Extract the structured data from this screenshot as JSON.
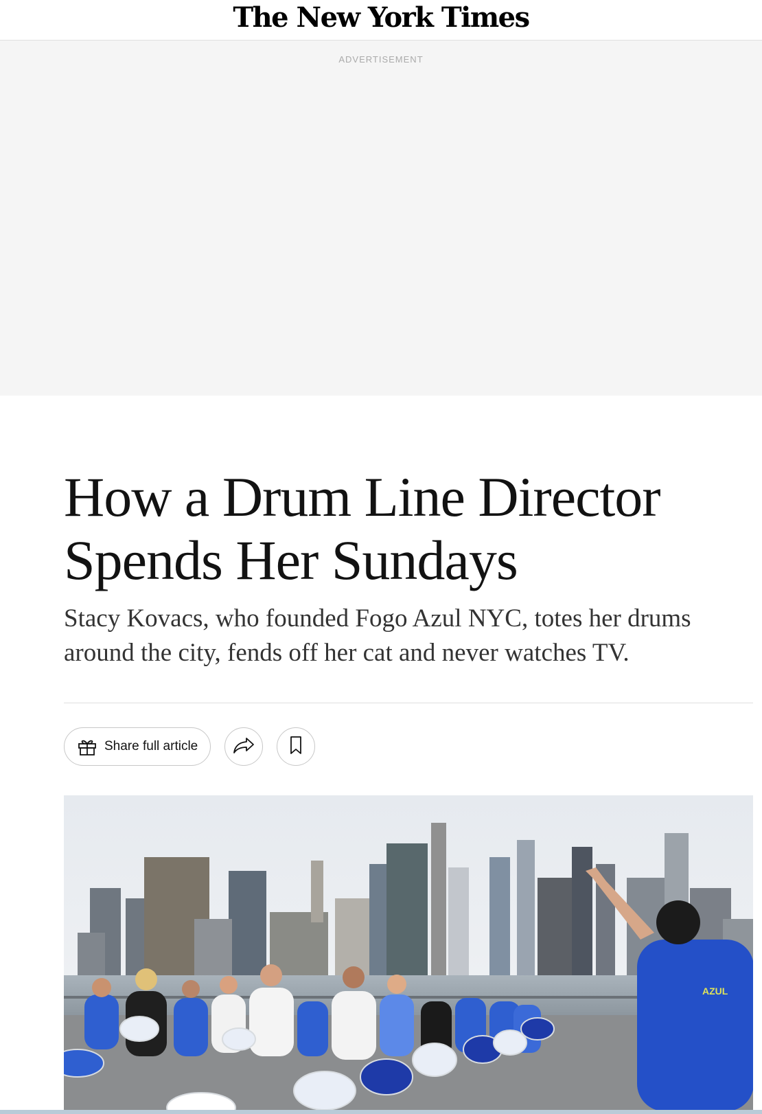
{
  "masthead": {
    "logo_text": "The New York Times"
  },
  "advertisement": {
    "label": "ADVERTISEMENT"
  },
  "article": {
    "headline_line1": "How a Drum Line Director",
    "headline_line2": "Spends Her Sundays",
    "summary": "Stacy Kovacs, who founded Fogo Azul NYC, totes her drums around the city, fends off her cat and never watches TV."
  },
  "share_bar": {
    "share_full_article_label": "Share full article",
    "share_icon": "gift-icon",
    "forward_icon": "share-arrow-icon",
    "save_icon": "bookmark-icon"
  },
  "colors": {
    "text": "#121212",
    "summary_text": "#333333",
    "ad_background": "#f5f5f5",
    "border": "#c7c7c7",
    "drum_group_shirt": "#2f5fd0"
  }
}
